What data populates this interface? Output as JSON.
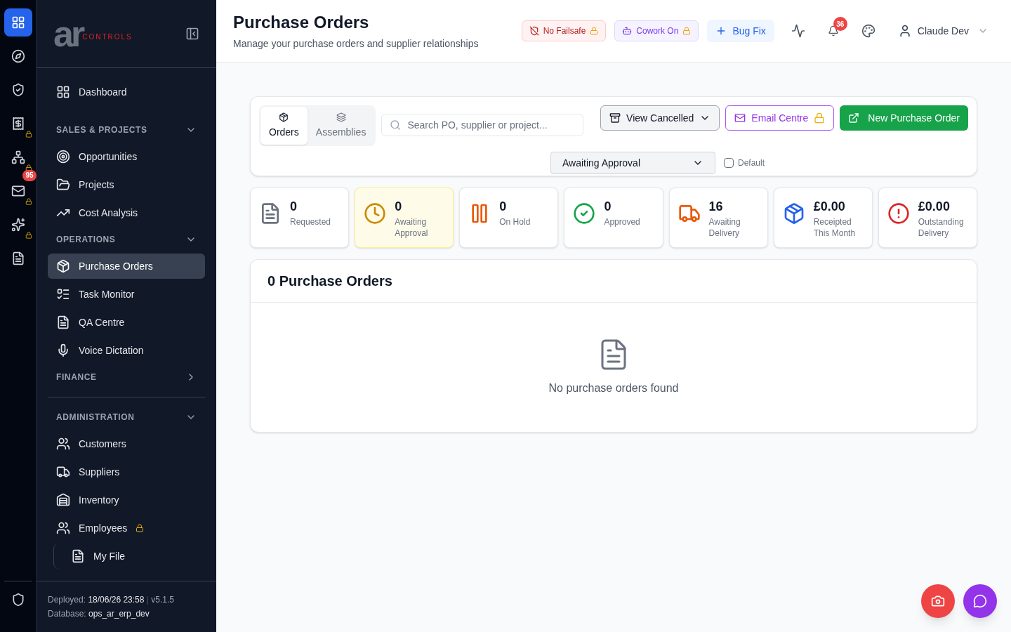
{
  "rail": {
    "items": [
      {
        "selected": true,
        "locked": false
      },
      {
        "selected": false,
        "locked": false
      },
      {
        "selected": false,
        "locked": false
      },
      {
        "selected": false,
        "locked": true
      },
      {
        "selected": false,
        "locked": true
      },
      {
        "selected": false,
        "locked": true,
        "badge": "95"
      },
      {
        "selected": false,
        "locked": true
      },
      {
        "selected": false,
        "locked": false
      }
    ]
  },
  "sidebar": {
    "logo": {
      "mark": "ar",
      "word": "CONTROLS"
    },
    "top_item": {
      "label": "Dashboard",
      "selected": false
    },
    "sections": [
      {
        "title": "SALES & PROJECTS",
        "expanded": true,
        "items": [
          {
            "label": "Opportunities",
            "selected": false,
            "locked": false
          },
          {
            "label": "Projects",
            "selected": false,
            "locked": false
          },
          {
            "label": "Cost Analysis",
            "selected": false,
            "locked": false
          }
        ]
      },
      {
        "title": "OPERATIONS",
        "expanded": true,
        "items": [
          {
            "label": "Purchase Orders",
            "selected": true,
            "locked": false
          },
          {
            "label": "Task Monitor",
            "selected": false,
            "locked": false
          },
          {
            "label": "QA Centre",
            "selected": false,
            "locked": false
          },
          {
            "label": "Voice Dictation",
            "selected": false,
            "locked": false
          }
        ]
      },
      {
        "title": "FINANCE",
        "expanded": false
      },
      {
        "title": "ADMINISTRATION",
        "expanded": true,
        "items": [
          {
            "label": "Customers",
            "selected": false,
            "locked": false
          },
          {
            "label": "Suppliers",
            "selected": false,
            "locked": false
          },
          {
            "label": "Inventory",
            "selected": false,
            "locked": false
          },
          {
            "label": "Employees",
            "selected": false,
            "locked": true,
            "children": [
              {
                "label": "My File",
                "selected": false,
                "locked": false
              }
            ]
          }
        ]
      }
    ],
    "footer": {
      "deployed_label": "Deployed:",
      "deployed": "18/06/26 23:58",
      "separator": "|",
      "version": "v5.1.5",
      "database_label": "Database:",
      "database": "ops_ar_erp_dev"
    }
  },
  "header": {
    "title": "Purchase Orders",
    "subtitle": "Manage your purchase orders and supplier relationships",
    "chips": [
      {
        "label": "No Failsafe",
        "kind": "failsafe",
        "locked": true
      },
      {
        "label": "Cowork On",
        "kind": "cowork",
        "locked": true
      }
    ],
    "bug_fix": "Bug Fix",
    "notifications": "36",
    "user": "Claude Dev"
  },
  "toolbar": {
    "tabs": [
      {
        "label": "Orders",
        "selected": true
      },
      {
        "label": "Assemblies",
        "selected": false
      }
    ],
    "search": {
      "placeholder": "Search PO, supplier or project..."
    },
    "view_cancelled": "View Cancelled",
    "status_select": "Awaiting Approval",
    "default_checkbox": {
      "label": "Default",
      "checked": false
    },
    "email_centre": {
      "label": "Email Centre",
      "locked": true
    },
    "new_order": "New Purchase Order"
  },
  "stats": [
    {
      "value": "0",
      "label": "Requested",
      "color": "#6b7280",
      "selected": false
    },
    {
      "value": "0",
      "label": "Awaiting Approval",
      "color": "#ca8a04",
      "selected": true
    },
    {
      "value": "0",
      "label": "On Hold",
      "color": "#ea580c",
      "selected": false
    },
    {
      "value": "0",
      "label": "Approved",
      "color": "#16a34a",
      "selected": false
    },
    {
      "value": "16",
      "label": "Awaiting Delivery",
      "color": "#ea580c",
      "selected": false
    },
    {
      "value": "£0.00",
      "label": "Receipted This Month",
      "color": "#2563eb",
      "selected": false
    },
    {
      "value": "£0.00",
      "label": "Outstanding Delivery",
      "color": "#dc2626",
      "selected": false
    }
  ],
  "list": {
    "title": "0 Purchase Orders",
    "empty": "No purchase orders found"
  }
}
